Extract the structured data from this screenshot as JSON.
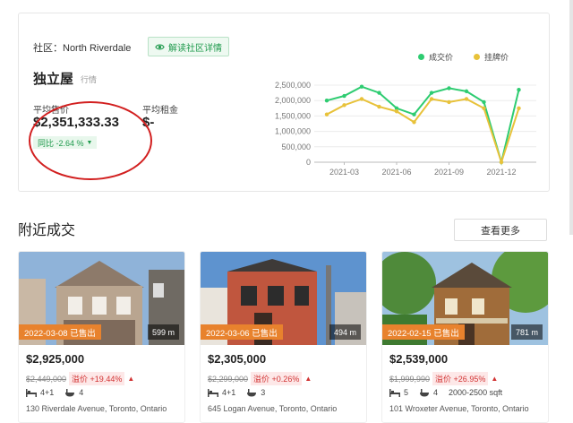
{
  "summary": {
    "community_label": "社区：North Riverdale",
    "reveal_button": "解读社区详情",
    "property_type": "独立屋",
    "property_sub": "行情",
    "avg_price_label": "平均售价",
    "avg_price": "$2,351,333.33",
    "avg_rent_label": "平均租金",
    "avg_rent": "$-",
    "yoy": "同比 -2.64 %"
  },
  "legend": {
    "sold_label": "成交价",
    "list_label": "挂牌价",
    "sold_color": "#2ecc71",
    "list_color": "#e8c23a"
  },
  "chart_data": {
    "type": "line",
    "x": [
      "2021-02",
      "2021-03",
      "2021-04",
      "2021-05",
      "2021-06",
      "2021-07",
      "2021-08",
      "2021-09",
      "2021-10",
      "2021-11",
      "2021-12",
      "2022-01",
      "2022-02"
    ],
    "x_tick_labels": [
      "2021-03",
      "2021-06",
      "2021-09",
      "2021-12"
    ],
    "x_tick_positions": [
      "2021-03",
      "2021-06",
      "2021-09",
      "2021-12"
    ],
    "y_ticks": [
      "0",
      "500,000",
      "1,000,000",
      "1,500,000",
      "2,000,000",
      "2,500,000"
    ],
    "ylim": [
      0,
      2500000
    ],
    "series": [
      {
        "name": "成交价",
        "color": "#2ecc71",
        "values": [
          2000000,
          2150000,
          2450000,
          2250000,
          1750000,
          1550000,
          2250000,
          2400000,
          2300000,
          1950000,
          0,
          2350000,
          null
        ]
      },
      {
        "name": "挂牌价",
        "color": "#e8c23a",
        "values": [
          1550000,
          1850000,
          2050000,
          1800000,
          1650000,
          1300000,
          2050000,
          1950000,
          2050000,
          1750000,
          0,
          1750000,
          null
        ]
      }
    ],
    "grid": true,
    "legend": "top-right"
  },
  "section": {
    "title": "附近成交",
    "more_button": "查看更多"
  },
  "listings": [
    {
      "sold": "2022-03-08 已售出",
      "distance": "599 m",
      "price": "$2,925,000",
      "list_price": "$2,449,000",
      "premium": "溢价 +19.44%",
      "beds": "4+1",
      "baths": "4",
      "sqft": "",
      "address": "130 Riverdale Avenue, Toronto, Ontario"
    },
    {
      "sold": "2022-03-06 已售出",
      "distance": "494 m",
      "price": "$2,305,000",
      "list_price": "$2,299,000",
      "premium": "溢价 +0.26%",
      "beds": "4+1",
      "baths": "3",
      "sqft": "",
      "address": "645 Logan Avenue, Toronto, Ontario"
    },
    {
      "sold": "2022-02-15 已售出",
      "distance": "781 m",
      "price": "$2,539,000",
      "list_price": "$1,999,990",
      "premium": "溢价 +26.95%",
      "beds": "5",
      "baths": "4",
      "sqft": "2000-2500 sqft",
      "address": "101 Wroxeter Avenue, Toronto, Ontario"
    }
  ]
}
